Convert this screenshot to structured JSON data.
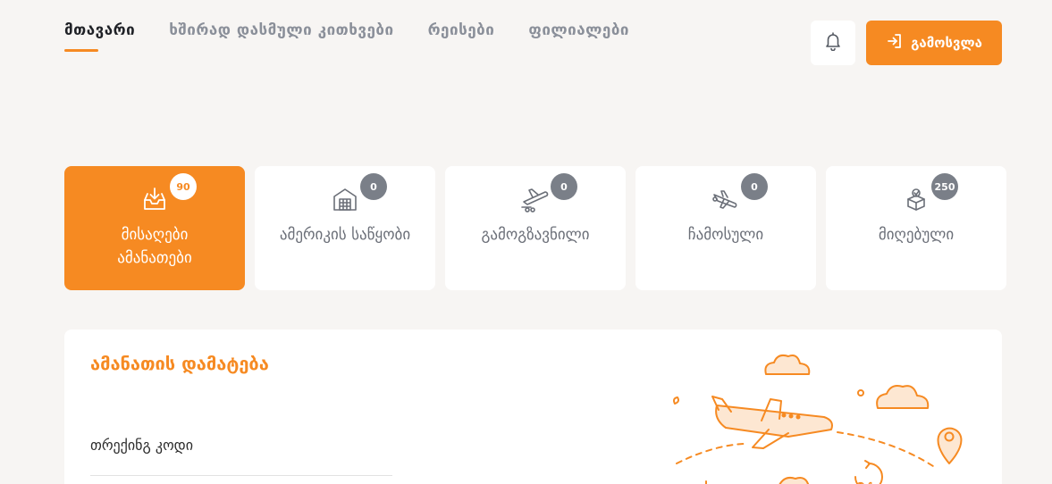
{
  "nav": {
    "items": [
      {
        "label": "მთავარი",
        "active": true
      },
      {
        "label": "ხშირად დასმული კითხვები",
        "active": false
      },
      {
        "label": "რეისები",
        "active": false
      },
      {
        "label": "ფილიალები",
        "active": false
      }
    ],
    "logout_label": "გამოსვლა"
  },
  "icons": {
    "bell": "bell-icon",
    "logout": "sign-out-icon",
    "cards": [
      "inbox-download-icon",
      "warehouse-icon",
      "plane-departure-icon",
      "plane-arrival-icon",
      "box-received-icon"
    ]
  },
  "cards": [
    {
      "label": "მისაღები ამანათები",
      "count": "90",
      "active": true
    },
    {
      "label": "ამერიკის საწყობი",
      "count": "0",
      "active": false
    },
    {
      "label": "გამოგზავნილი",
      "count": "0",
      "active": false
    },
    {
      "label": "ჩამოსული",
      "count": "0",
      "active": false
    },
    {
      "label": "მიღებული",
      "count": "250",
      "active": false
    }
  ],
  "panel": {
    "title": "ამანათის დამატება",
    "tracking_label": "თრექინგ კოდი",
    "tracking_value": ""
  },
  "colors": {
    "accent": "#f68a22",
    "background": "#f7f5f3",
    "badge": "#7a7f88",
    "muted_text": "#8a8f99"
  }
}
